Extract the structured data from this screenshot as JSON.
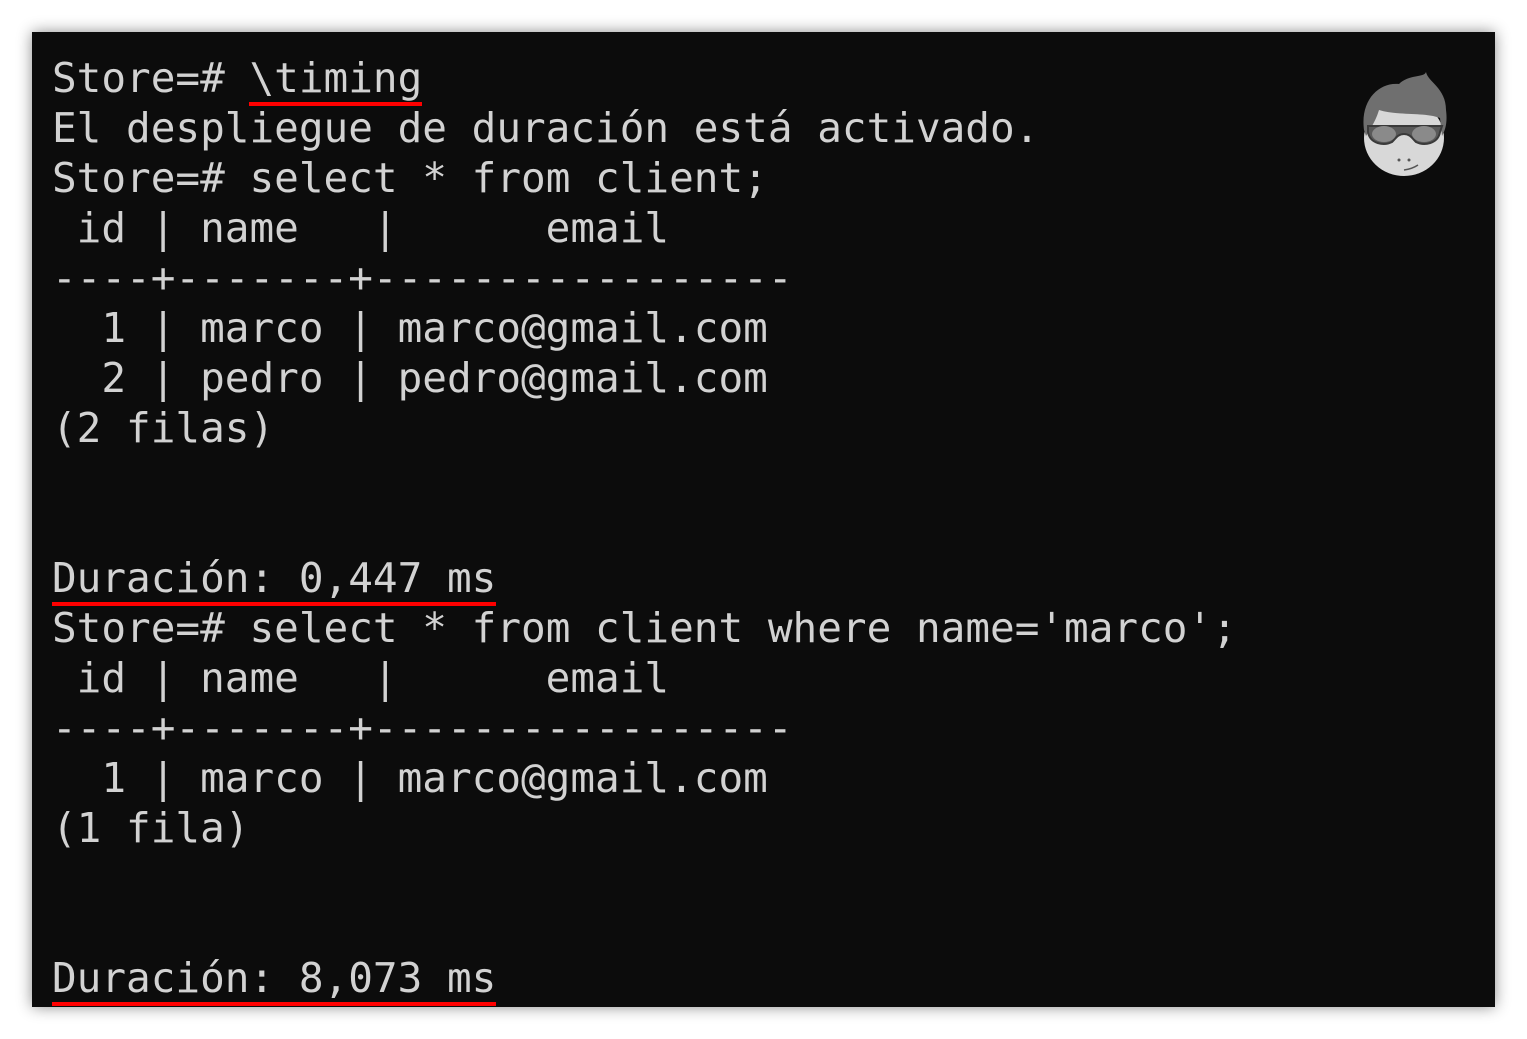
{
  "terminal": {
    "lines": [
      {
        "prompt": "Store=# ",
        "text": "\\timing",
        "underline": true
      },
      {
        "text": "El despliegue de duración está activado."
      },
      {
        "prompt": "Store=# ",
        "text": "select * from client;"
      },
      {
        "text": " id | name   |      email"
      },
      {
        "text": "----+-------+-----------------"
      },
      {
        "text": "  1 | marco | marco@gmail.com"
      },
      {
        "text": "  2 | pedro | pedro@gmail.com"
      },
      {
        "text": "(2 filas)"
      },
      {
        "text": ""
      },
      {
        "text": ""
      },
      {
        "text": "Duración: 0,447 ms",
        "underline": true
      },
      {
        "prompt": "Store=# ",
        "text": "select * from client where name='marco';"
      },
      {
        "text": " id | name   |      email"
      },
      {
        "text": "----+-------+-----------------"
      },
      {
        "text": "  1 | marco | marco@gmail.com"
      },
      {
        "text": "(1 fila)"
      },
      {
        "text": ""
      },
      {
        "text": ""
      },
      {
        "text": "Duración: 8,073 ms",
        "underline": true
      }
    ],
    "colors": {
      "background": "#0c0c0c",
      "text": "#d2d2d2",
      "highlight": "#ff0000"
    }
  },
  "avatar": {
    "icon": "cartoon-face-with-sunglasses-icon"
  }
}
